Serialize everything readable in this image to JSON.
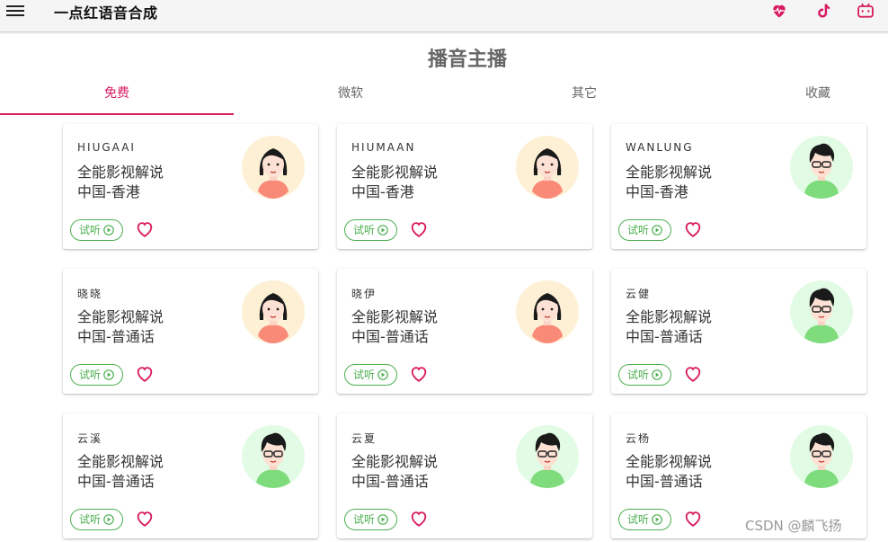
{
  "app": {
    "title": "一点红语音合成",
    "page_title": "播音主播",
    "menu_icon": "menu-icon",
    "top_icons": [
      "heart-pulse-icon",
      "tiktok-icon",
      "bilibili-icon"
    ],
    "accent_color": "#d81b60",
    "green_color": "#4caf50"
  },
  "tabs": [
    {
      "label": "免费",
      "active": true
    },
    {
      "label": "微软",
      "active": false
    },
    {
      "label": "其它",
      "active": false
    },
    {
      "label": "收藏",
      "active": false
    }
  ],
  "cards": [
    {
      "name": "HIUGAAI",
      "desc": "全能影视解说",
      "region": "中国-香港",
      "avatar": "female",
      "listen": "试听"
    },
    {
      "name": "HIUMAAN",
      "desc": "全能影视解说",
      "region": "中国-香港",
      "avatar": "female",
      "listen": "试听"
    },
    {
      "name": "WANLUNG",
      "desc": "全能影视解说",
      "region": "中国-香港",
      "avatar": "male",
      "listen": "试听"
    },
    {
      "name": "晓晓",
      "desc": "全能影视解说",
      "region": "中国-普通话",
      "avatar": "female",
      "listen": "试听"
    },
    {
      "name": "晓伊",
      "desc": "全能影视解说",
      "region": "中国-普通话",
      "avatar": "female",
      "listen": "试听"
    },
    {
      "name": "云健",
      "desc": "全能影视解说",
      "region": "中国-普通话",
      "avatar": "male",
      "listen": "试听"
    },
    {
      "name": "云溪",
      "desc": "全能影视解说",
      "region": "中国-普通话",
      "avatar": "male",
      "listen": "试听"
    },
    {
      "name": "云夏",
      "desc": "全能影视解说",
      "region": "中国-普通话",
      "avatar": "male",
      "listen": "试听"
    },
    {
      "name": "云杨",
      "desc": "全能影视解说",
      "region": "中国-普通话",
      "avatar": "male",
      "listen": "试听"
    }
  ],
  "watermark": "CSDN @麟飞扬"
}
